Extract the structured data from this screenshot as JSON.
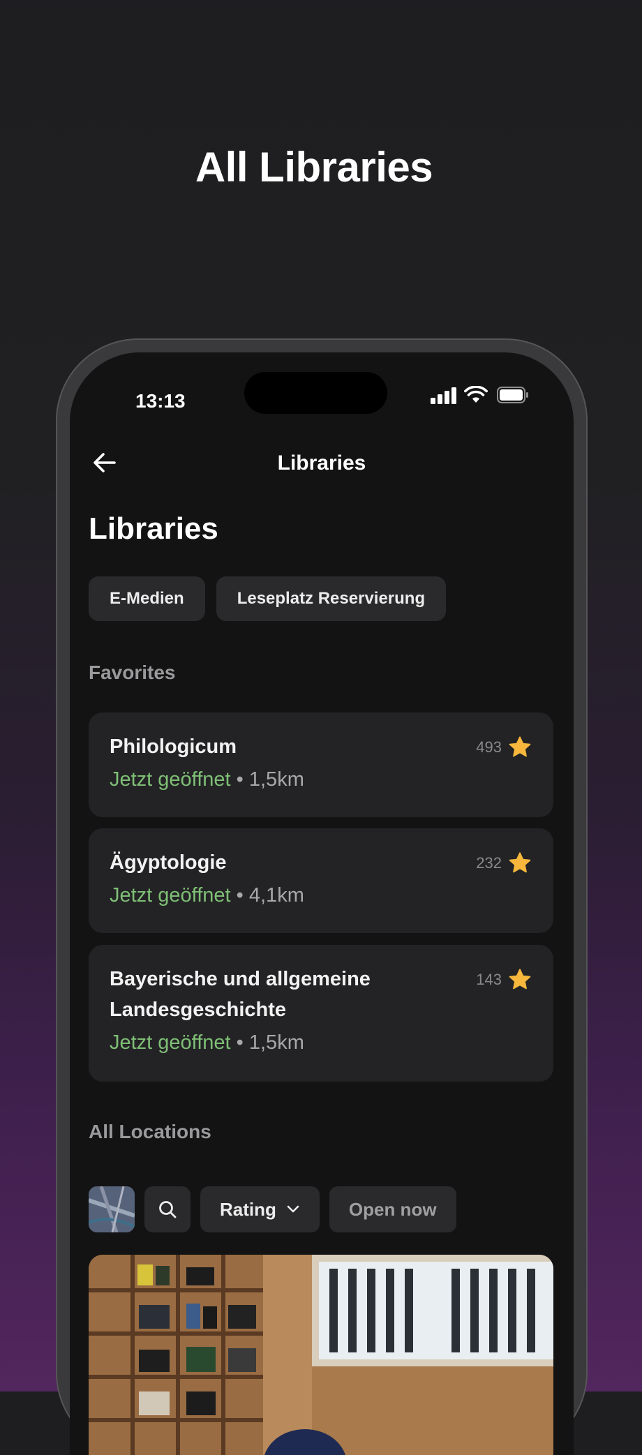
{
  "headline": "All Libraries",
  "status_bar": {
    "time": "13:13",
    "icons": [
      "cellular-signal-icon",
      "wifi-icon",
      "battery-icon"
    ]
  },
  "navbar": {
    "title": "Libraries",
    "back_icon": "arrow-left-icon"
  },
  "page_title": "Libraries",
  "quick_actions": [
    "E-Medien",
    "Leseplatz Reservierung"
  ],
  "favorites": {
    "label": "Favorites",
    "items": [
      {
        "name": "Philologicum",
        "status": "Jetzt geöffnet",
        "separator": "•",
        "distance": "1,5km",
        "rating_count": "493"
      },
      {
        "name": "Ägyptologie",
        "status": "Jetzt geöffnet",
        "separator": "•",
        "distance": "4,1km",
        "rating_count": "232"
      },
      {
        "name": "Bayerische und allgemeine Landesgeschichte",
        "status": "Jetzt geöffnet",
        "separator": "•",
        "distance": "1,5km",
        "rating_count": "143"
      }
    ]
  },
  "all_locations": {
    "label": "All Locations",
    "filters": {
      "sort_label": "Rating",
      "open_now_label": "Open now"
    }
  },
  "colors": {
    "open_status": "#7fbf76",
    "star": "#f6b73c",
    "card_bg": "#232325",
    "screen_bg": "#131314"
  }
}
